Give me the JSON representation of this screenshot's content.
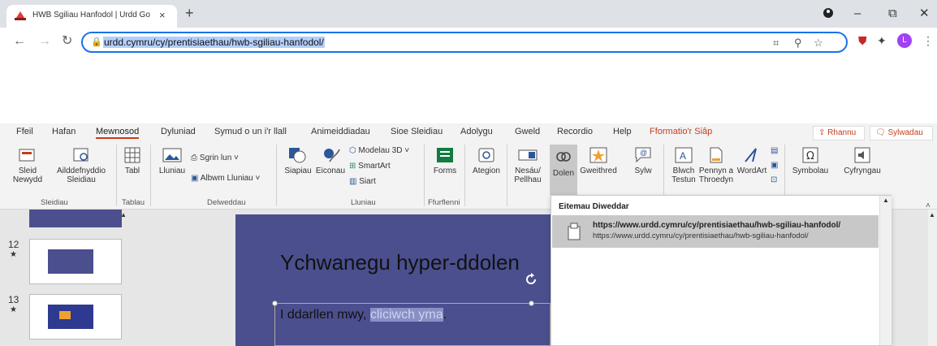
{
  "browser": {
    "tab_title": "HWB Sgiliau Hanfodol | Urdd Go",
    "tab_close": "×",
    "new_tab": "+",
    "url": "urdd.cymru/cy/prentisiaethau/hwb-sgiliau-hanfodol/",
    "avatar_letter": "L",
    "win_min": "–",
    "win_max": "⧉",
    "win_close": "✕"
  },
  "ppt": {
    "menus": [
      "Ffeil",
      "Hafan",
      "Mewnosod",
      "Dyluniad",
      "Symud o un i'r llall",
      "Animeiddiadau",
      "Sioe Sleidiau",
      "Adolygu",
      "Gweld",
      "Recordio",
      "Help",
      "Fformatio'r Siâp"
    ],
    "share": "Rhannu",
    "comments": "Sylwadau",
    "buttons": {
      "new_slide": "Sleid Newydd",
      "reuse": "Ailddefnyddio Sleidiau",
      "table": "Tabl",
      "pictures": "Lluniau",
      "screenshot": "Sgrin lun",
      "photo_album": "Albwm Lluniau",
      "shapes": "Siapiau",
      "icons": "Eiconau",
      "models3d": "Modelau 3D",
      "smartart": "SmartArt",
      "chart": "Siart",
      "forms": "Forms",
      "addins": "Ategion",
      "zoom": "Nesáu/ Pellhau",
      "link": "Dolen",
      "action": "Gweithred",
      "comment": "Sylw",
      "textbox": "Blwch Testun",
      "header_footer": "Pennyn a Throedyn",
      "wordart": "WordArt",
      "symbols": "Symbolau",
      "media": "Cyfryngau"
    },
    "groups": {
      "slides": "Sleidiau",
      "tables": "Tablau",
      "images": "Delweddau",
      "illustrations": "Lluniau",
      "forms": "Ffurflenni"
    },
    "thumbs": [
      "12",
      "13"
    ],
    "slide_title": "Ychwanegu hyper-ddolen",
    "slide_text_prefix": "I ddarllen mwy, ",
    "slide_link_text": "cliciwch yma",
    "slide_text_suffix": ".",
    "dropdown": {
      "header": "Eitemau Diweddar",
      "item_title": "https://www.urdd.cymru/cy/prentisiaethau/hwb-sgiliau-hanfodol/",
      "item_sub": "https://www.urdd.cymru/cy/prentisiaethau/hwb-sgiliau-hanfodol/"
    }
  }
}
